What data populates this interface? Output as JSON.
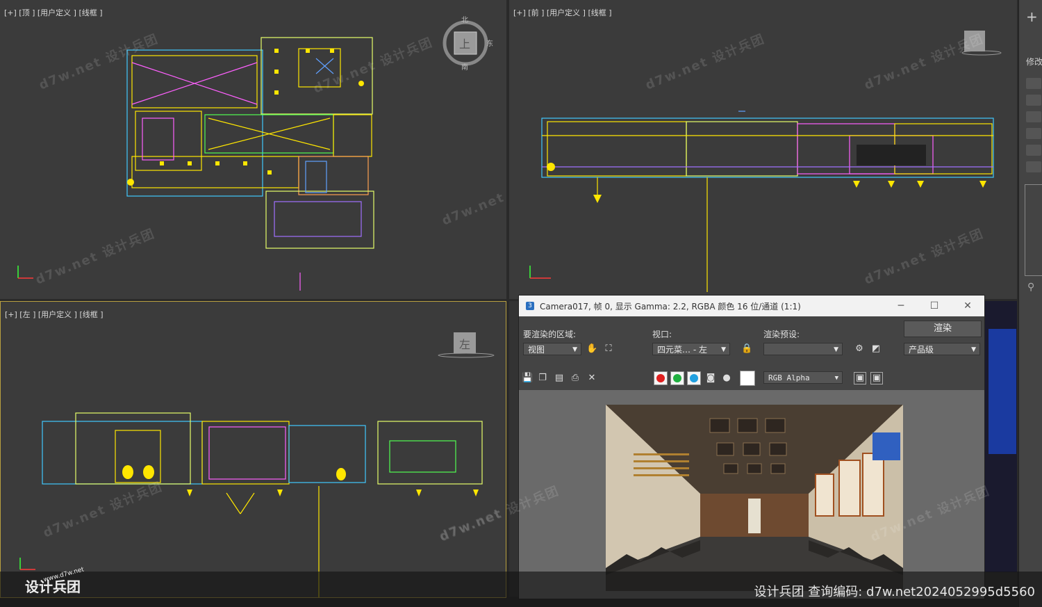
{
  "viewports": {
    "top": {
      "label": "[+] [顶 ] [用户定义 ] [线框 ]",
      "cube_face": "上",
      "compass": {
        "n": "北",
        "e": "东",
        "s": "南"
      }
    },
    "front": {
      "label": "[+] [前 ] [用户定义 ] [线框 ]"
    },
    "left": {
      "label": "[+] [左 ] [用户定义 ] [线框 ]",
      "cube_face": "左"
    }
  },
  "watermark": {
    "text": "d7w.net 设计兵团"
  },
  "command_panel": {
    "add_icon": "+",
    "tab_label": "修改"
  },
  "render_window": {
    "title": "Camera017, 帧 0, 显示 Gamma: 2.2, RGBA 颜色 16 位/通道 (1:1)",
    "app_icon": "3",
    "area_label": "要渲染的区域:",
    "area_value": "视图",
    "viewport_label": "视口:",
    "viewport_value": "四元菜… - 左",
    "preset_label": "渲染预设:",
    "preset_value": "",
    "render_button": "渲染",
    "quality_value": "产品级",
    "channel_value": "RGB Alpha"
  },
  "footer": {
    "text": "设计兵团 查询编码: d7w.net2024052995d5560",
    "logo_text": "设计兵团",
    "logo_url": "www.d7w.net"
  }
}
